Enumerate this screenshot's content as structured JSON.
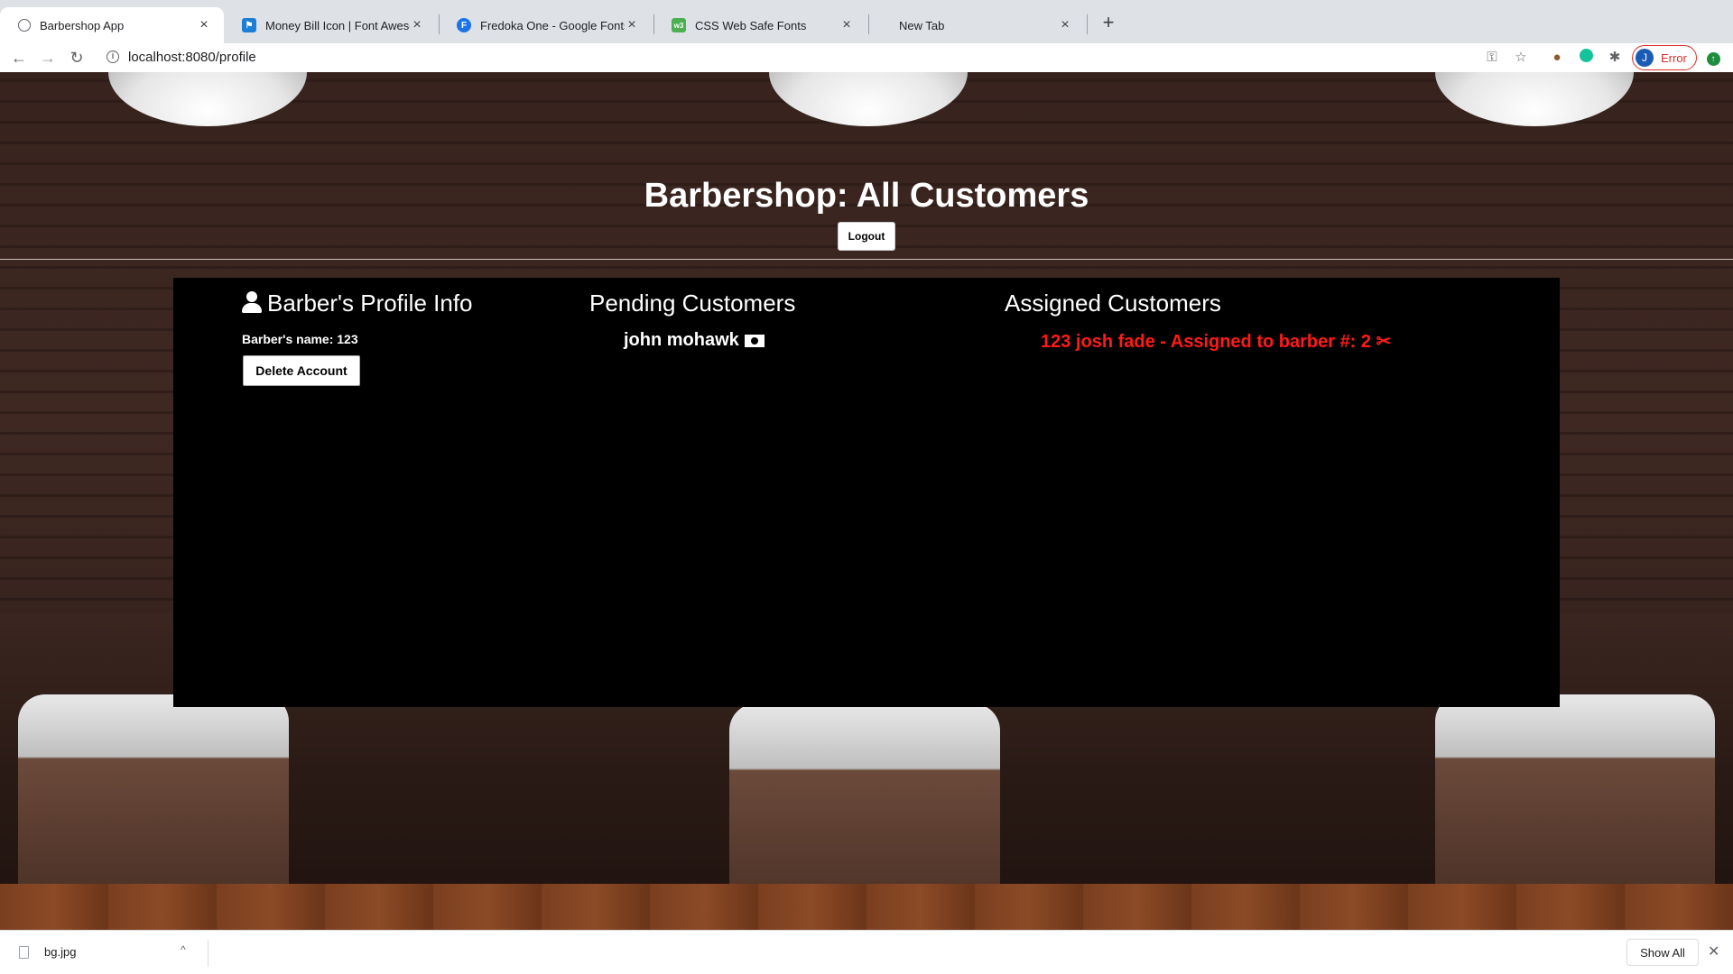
{
  "browser": {
    "tabs": [
      {
        "title": "Barbershop App",
        "active": true,
        "icon": "globe-icon"
      },
      {
        "title": "Money Bill Icon | Font Awesome",
        "active": false,
        "icon": "flag-icon"
      },
      {
        "title": "Fredoka One - Google Fonts",
        "active": false,
        "icon": "f-letter-icon"
      },
      {
        "title": "CSS Web Safe Fonts",
        "active": false,
        "icon": "w3-icon"
      },
      {
        "title": "New Tab",
        "active": false,
        "icon": ""
      }
    ],
    "url": "localhost:8080/profile",
    "profile_initial": "J",
    "profile_status": "Error"
  },
  "page": {
    "title": "Barbershop: All Customers",
    "logout_label": "Logout"
  },
  "profile": {
    "heading": "Barber's Profile Info",
    "barber_name_text": "Barber's name: 123",
    "delete_label": "Delete Account"
  },
  "pending": {
    "heading": "Pending Customers",
    "items": [
      "john mohawk"
    ]
  },
  "assigned": {
    "heading": "Assigned Customers",
    "items": [
      "123 josh fade - Assigned to barber #: 2"
    ]
  },
  "downloads": {
    "file_name": "bg.jpg",
    "show_all_label": "Show All"
  },
  "colors": {
    "assigned_text": "#ff1a1a",
    "panel_bg": "#000000",
    "error_accent": "#d93025"
  }
}
